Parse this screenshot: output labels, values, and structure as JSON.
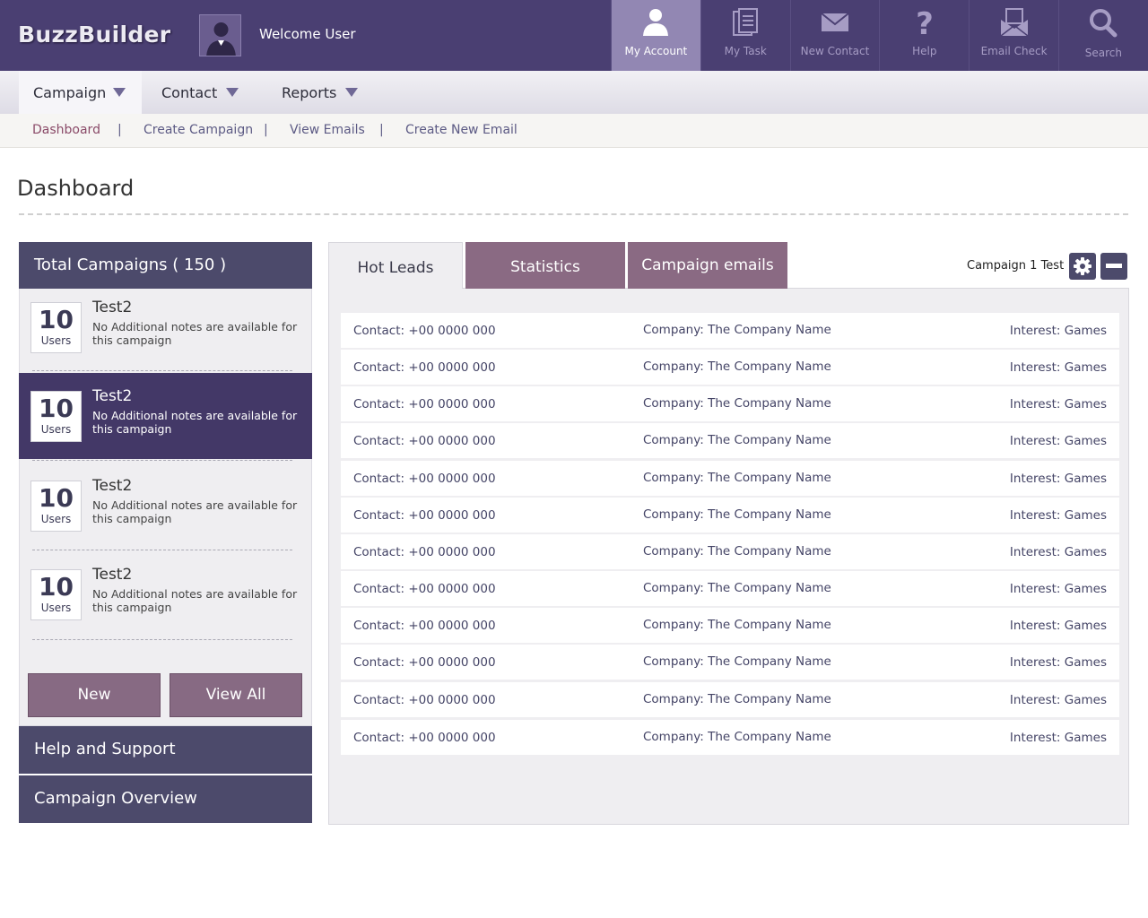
{
  "app": {
    "logo": "BuzzBuilder",
    "welcome": "Welcome User"
  },
  "topnav": [
    {
      "label": "My Account",
      "icon": "user-icon",
      "active": true
    },
    {
      "label": "My Task",
      "icon": "clipboard-icon"
    },
    {
      "label": "New Contact",
      "icon": "envelope-icon"
    },
    {
      "label": "Help",
      "icon": "question-icon"
    },
    {
      "label": "Email Check",
      "icon": "open-envelope-icon"
    },
    {
      "label": "Search",
      "icon": "search-icon"
    }
  ],
  "menu": [
    {
      "label": "Campaign",
      "active": true
    },
    {
      "label": "Contact"
    },
    {
      "label": "Reports"
    }
  ],
  "subnav": [
    {
      "label": "Dashboard",
      "active": true
    },
    {
      "label": "Create Campaign"
    },
    {
      "label": "View Emails"
    },
    {
      "label": "Create New Email"
    }
  ],
  "subnav_separator": "|",
  "page": {
    "title": "Dashboard"
  },
  "campaigns": {
    "header": "Total Campaigns ( 150 )",
    "items": [
      {
        "count": "10",
        "unit": "Users",
        "name": "Test2",
        "note": "No Additional notes are available for this campaign"
      },
      {
        "count": "10",
        "unit": "Users",
        "name": "Test2",
        "note": "No Additional notes are available for this campaign",
        "selected": true
      },
      {
        "count": "10",
        "unit": "Users",
        "name": "Test2",
        "note": "No Additional notes are available for this campaign"
      },
      {
        "count": "10",
        "unit": "Users",
        "name": "Test2",
        "note": "No Additional notes are available for this campaign"
      }
    ],
    "new_button": "New",
    "view_all_button": "View All"
  },
  "sections": {
    "help": "Help and Support",
    "overview": "Campaign Overview"
  },
  "tabs": {
    "hot_leads": "Hot Leads",
    "statistics": "Statistics",
    "campaign_emails": "Campaign emails",
    "active": "Hot Leads"
  },
  "campaign_label": "Campaign 1 Test",
  "leads": [
    {
      "contact": "Contact: +00 0000 000",
      "company": "Company: The Company Name",
      "interest": "Interest: Games"
    },
    {
      "contact": "Contact: +00 0000 000",
      "company": "Company: The Company Name",
      "interest": "Interest: Games"
    },
    {
      "contact": "Contact: +00 0000 000",
      "company": "Company: The Company Name",
      "interest": "Interest: Games"
    },
    {
      "contact": "Contact: +00 0000 000",
      "company": "Company: The Company Name",
      "interest": "Interest: Games"
    },
    {
      "contact": "Contact: +00 0000 000",
      "company": "Company: The Company Name",
      "interest": "Interest: Games"
    },
    {
      "contact": "Contact: +00 0000 000",
      "company": "Company: The Company Name",
      "interest": "Interest: Games"
    },
    {
      "contact": "Contact: +00 0000 000",
      "company": "Company: The Company Name",
      "interest": "Interest: Games"
    },
    {
      "contact": "Contact: +00 0000 000",
      "company": "Company: The Company Name",
      "interest": "Interest: Games"
    },
    {
      "contact": "Contact: +00 0000 000",
      "company": "Company: The Company Name",
      "interest": "Interest: Games"
    },
    {
      "contact": "Contact: +00 0000 000",
      "company": "Company: The Company Name",
      "interest": "Interest: Games"
    },
    {
      "contact": "Contact: +00 0000 000",
      "company": "Company: The Company Name",
      "interest": "Interest: Games"
    },
    {
      "contact": "Contact: +00 0000 000",
      "company": "Company: The Company Name",
      "interest": "Interest: Games"
    }
  ],
  "colors": {
    "header_bg": "#4a3f72",
    "active_nav": "#9287b3",
    "panel_head": "#4c4a6b",
    "selected_item": "#433867",
    "accent_button": "#876a83"
  }
}
